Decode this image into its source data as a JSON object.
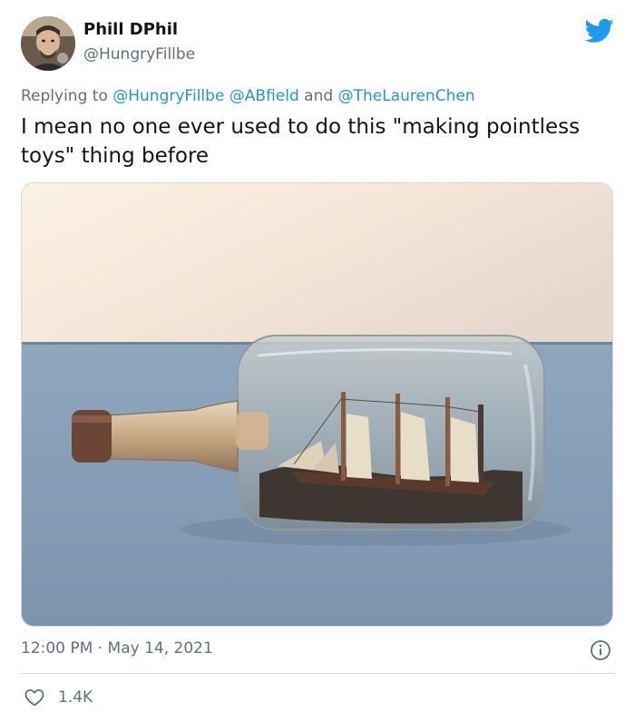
{
  "author": {
    "display_name": "Phill DPhil",
    "handle": "@HungryFillbe"
  },
  "reply": {
    "prefix": "Replying to ",
    "mentions": [
      "@HungryFillbe",
      "@ABfield",
      "@TheLaurenChen"
    ],
    "joiner": " and "
  },
  "tweet": {
    "text": "I mean no one ever used to do this \"making pointless toys\" thing before"
  },
  "media": {
    "icon": "ship-in-bottle-photo"
  },
  "meta": {
    "time": "12:00 PM",
    "separator": " · ",
    "date": "May 14, 2021"
  },
  "engagement": {
    "likes": "1.4K"
  },
  "colors": {
    "brand_blue": "#1d9bf0",
    "link_blue": "#1b95e0",
    "muted_text": "#5b7083",
    "divider": "#cfd9de"
  }
}
